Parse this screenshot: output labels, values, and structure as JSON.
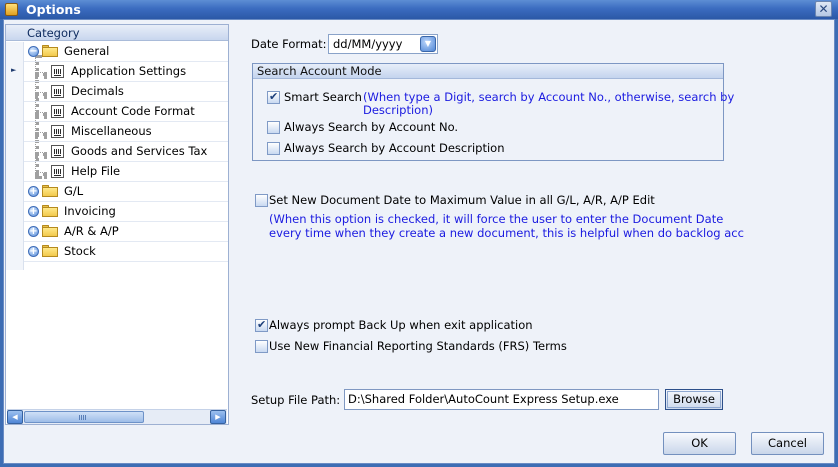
{
  "window": {
    "title": "Options"
  },
  "nav": {
    "header": "Category",
    "tree": [
      {
        "label": "General",
        "expanded": true,
        "children": [
          "Application Settings",
          "Decimals",
          "Account Code Format",
          "Miscellaneous",
          "Goods and Services Tax",
          "Help File"
        ]
      },
      {
        "label": "G/L",
        "expanded": false
      },
      {
        "label": "Invoicing",
        "expanded": false
      },
      {
        "label": "A/R & A/P",
        "expanded": false
      },
      {
        "label": "Stock",
        "expanded": false
      }
    ],
    "scroll_thumb_grip": "III"
  },
  "date_format": {
    "label": "Date Format:",
    "value": "dd/MM/yyyy"
  },
  "search_mode": {
    "title": "Search Account Mode",
    "options": [
      {
        "label": "Smart Search",
        "checked": true,
        "note_line1": "(When type a Digit, search by Account No., otherwise, search by",
        "note_line2": "Description)"
      },
      {
        "label": "Always Search by Account No.",
        "checked": false
      },
      {
        "label": "Always Search by Account Description",
        "checked": false
      }
    ]
  },
  "doc_date": {
    "label": "Set New Document Date to Maximum Value in all G/L, A/R, A/P Edit",
    "checked": false,
    "note_line1": "(When this option is checked, it will force the user to enter the Document Date",
    "note_line2": "every time when they create a new document, this is helpful when do backlog acc"
  },
  "backup_prompt": {
    "label": "Always prompt Back Up when exit application",
    "checked": true
  },
  "frs_terms": {
    "label": "Use New Financial Reporting Standards (FRS) Terms",
    "checked": false
  },
  "setup_path": {
    "label": "Setup File Path:",
    "value": "D:\\Shared Folder\\AutoCount Express Setup.exe",
    "browse": "Browse"
  },
  "buttons": {
    "ok": "OK",
    "cancel": "Cancel"
  },
  "colors": {
    "title_bar": "#3b6cc0",
    "note_text": "#1a1ae0",
    "panel_bg": "#eef2f9"
  }
}
